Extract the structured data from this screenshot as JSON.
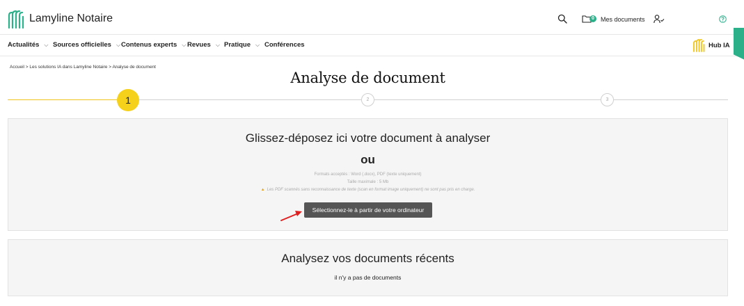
{
  "header": {
    "brand": "Lamyline Notaire",
    "docs_count": "0",
    "docs_label": "Mes documents",
    "icons": [
      "search-icon",
      "folder-icon",
      "user-check-icon",
      "help-circle-icon"
    ]
  },
  "nav": {
    "items": [
      {
        "label": "Actualités",
        "has_dropdown": true
      },
      {
        "label": "Sources officielles",
        "has_dropdown": true
      },
      {
        "label": "Contenus experts",
        "has_dropdown": true
      },
      {
        "label": "Revues",
        "has_dropdown": true
      },
      {
        "label": "Pratique",
        "has_dropdown": true
      },
      {
        "label": "Conférences",
        "has_dropdown": false
      }
    ],
    "hub_label": "Hub IA"
  },
  "breadcrumb": {
    "home": "Accueil",
    "section": "Les solutions IA dans Lamyline Notaire",
    "current": "Analyse de document",
    "separator": ">"
  },
  "page": {
    "title": "Analyse de document"
  },
  "stepper": {
    "steps": [
      "1",
      "2",
      "3"
    ],
    "active_step": 1
  },
  "dropzone": {
    "title": "Glissez-déposez ici votre document à analyser",
    "or": "ou",
    "formats": "Formats acceptés : Word (.docx), PDF (texte uniquement)",
    "max_size": "Taille maximale : 5 Mb",
    "warning": "Les PDF scannés sans reconnaissance de texte (scan en format image uniquement) ne sont pas pris en charge.",
    "button_label": "Sélectionnez-le à partir de votre ordinateur"
  },
  "recent": {
    "title": "Analysez vos documents récents",
    "empty": "il n'y a pas de documents"
  },
  "colors": {
    "accent_green": "#2bb08a",
    "step_active": "#f5d11c",
    "button_bg": "#555555",
    "arrow": "#e02020"
  }
}
